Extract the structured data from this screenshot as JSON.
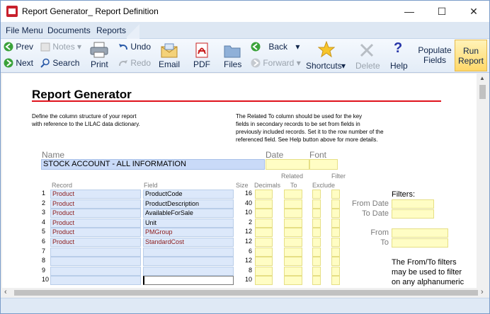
{
  "window": {
    "title": "Report Generator_ Report Definition",
    "minimize": "—",
    "maximize": "☐",
    "close": "✕"
  },
  "menu": [
    "File Menu",
    "Documents",
    "Reports"
  ],
  "ribbon": {
    "prev": "Prev",
    "next": "Next",
    "notes": "Notes",
    "search": "Search",
    "print": "Print",
    "undo": "Undo",
    "redo": "Redo",
    "email": "Email",
    "pdf": "PDF",
    "files": "Files",
    "back": "Back",
    "forward": "Forward",
    "shortcuts": "Shortcuts",
    "delete": "Delete",
    "help": "Help",
    "populate": "Populate Fields",
    "run": "Run Report"
  },
  "doc": {
    "heading": "Report Generator",
    "intro_left": [
      "Define the column structure of your report",
      "with reference to the LILAC data dictionary."
    ],
    "intro_right": [
      "The Related To column should be used for the key",
      "fields in secondary records to be set from fields in",
      "previously included records. Set it to the row number of the",
      "referenced field. See Help button above for more details."
    ],
    "name_label": "Name",
    "date_label": "Date",
    "font_label": "Font",
    "name_value": "STOCK ACCOUNT - ALL INFORMATION",
    "col_record": "Record",
    "col_field": "Field",
    "col_size": "Size",
    "col_decimals": "Decimals",
    "col_related": "Related",
    "col_to": "To",
    "col_filter": "Filter",
    "col_exclude": "Exclude",
    "rows": [
      {
        "num": "1",
        "record": "Product",
        "field": "ProductCode",
        "size": "16",
        "field_red": false
      },
      {
        "num": "2",
        "record": "Product",
        "field": "ProductDescription",
        "size": "40",
        "field_red": false
      },
      {
        "num": "3",
        "record": "Product",
        "field": "AvailableForSale",
        "size": "10",
        "field_red": false
      },
      {
        "num": "4",
        "record": "Product",
        "field": "Unit",
        "size": "2",
        "field_red": false
      },
      {
        "num": "5",
        "record": "Product",
        "field": "PMGroup",
        "size": "12",
        "field_red": true
      },
      {
        "num": "6",
        "record": "Product",
        "field": "StandardCost",
        "size": "12",
        "field_red": true
      },
      {
        "num": "7",
        "record": "",
        "field": "",
        "size": "6",
        "field_red": false
      },
      {
        "num": "8",
        "record": "",
        "field": "",
        "size": "12",
        "field_red": false
      },
      {
        "num": "9",
        "record": "",
        "field": "",
        "size": "8",
        "field_red": false
      },
      {
        "num": "10",
        "record": "",
        "field": "",
        "size": "10",
        "field_red": false
      }
    ],
    "filters_title": "Filters:",
    "from_date": "From Date",
    "to_date": "To Date",
    "from": "From",
    "to": "To",
    "filter_note": [
      "The From/To filters",
      "may be used to filter",
      "on any alphanumeric"
    ]
  },
  "colors": {
    "accent_red": "#e0121c",
    "field_blue": "#c9daf8",
    "yellow": "#fffdc4"
  }
}
